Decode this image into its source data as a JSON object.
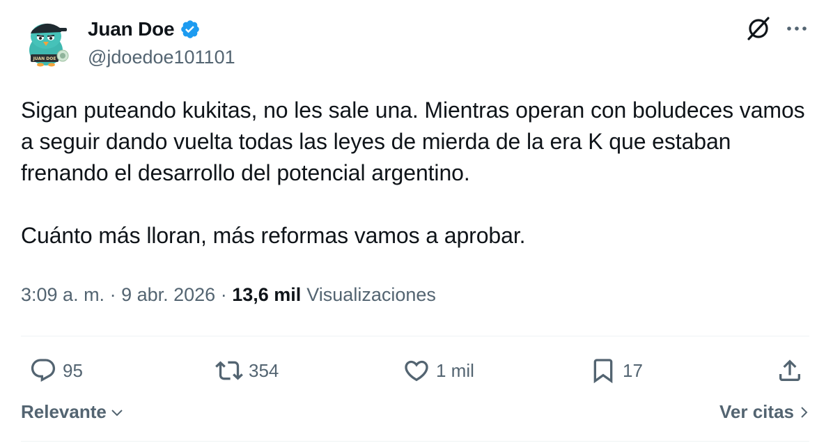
{
  "author": {
    "display_name": "Juan Doe",
    "handle": "@jdoedoe101101",
    "verified": true,
    "verified_color": "#1d9bf0",
    "avatar_badge": "JUAN DOE"
  },
  "tweet": {
    "paragraphs": [
      "Sigan puteando kukitas, no les sale una. Mientras operan con boludeces vamos a seguir dando vuelta todas las leyes de mierda de la era K que estaban frenando el desarrollo del potencial argentino.",
      "Cuánto más lloran, más reformas vamos a aprobar."
    ]
  },
  "meta": {
    "time": "3:09 a. m.",
    "separator": " · ",
    "date": "9 abr. 2026",
    "views_count": "13,6 mil",
    "views_label": "Visualizaciones"
  },
  "actions": {
    "replies": "95",
    "reposts": "354",
    "likes": "1 mil",
    "bookmarks": "17"
  },
  "footer": {
    "sort_label": "Relevante",
    "quotes_label": "Ver citas"
  },
  "icons": {
    "grok": "grok-icon",
    "more": "more-icon",
    "reply": "reply-icon",
    "repost": "repost-icon",
    "like": "heart-icon",
    "bookmark": "bookmark-icon",
    "share": "share-icon"
  },
  "colors": {
    "text": "#0f1419",
    "secondary": "#536471",
    "avatar_teal": "#3fb8b0"
  }
}
